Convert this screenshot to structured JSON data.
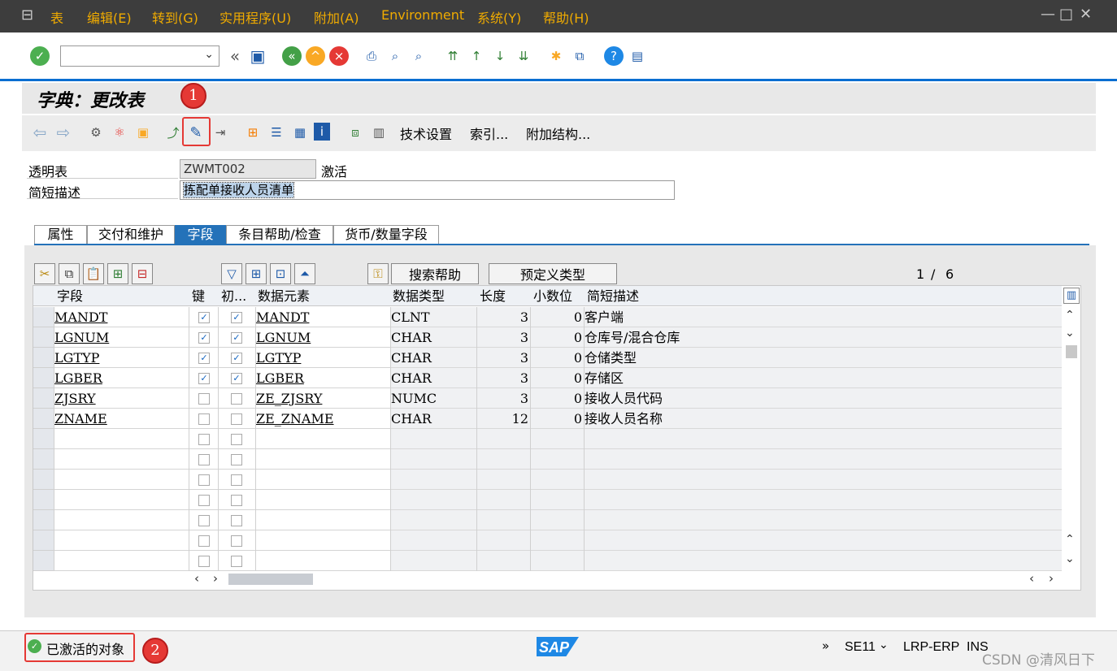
{
  "menu": {
    "items": [
      "表",
      "编辑(E)",
      "转到(G)",
      "实用程序(U)",
      "附加(A)",
      "Environment",
      "系统(Y)",
      "帮助(H)"
    ]
  },
  "window_controls": [
    "—",
    "□",
    "✕"
  ],
  "title": "字典：更改表",
  "app_toolbar": {
    "tech_settings": "技术设置",
    "index": "索引...",
    "append_structure": "附加结构..."
  },
  "form": {
    "table_label": "透明表",
    "table_name": "ZWMT002",
    "status": "激活",
    "desc_label": "简短描述",
    "desc_value": "拣配单接收人员清单"
  },
  "tabs": [
    "属性",
    "交付和维护",
    "字段",
    "条目帮助/检查",
    "货币/数量字段"
  ],
  "active_tab": "字段",
  "grid_toolbar": {
    "search_help": "搜索帮助",
    "predefined_type": "预定义类型",
    "page_current": "1",
    "page_sep": "/",
    "page_total": "6"
  },
  "columns": [
    "字段",
    "键",
    "初...",
    "数据元素",
    "数据类型",
    "长度",
    "小数位",
    "简短描述"
  ],
  "rows": [
    {
      "field": "MANDT",
      "key": true,
      "init": true,
      "element": "MANDT",
      "type": "CLNT",
      "length": "3",
      "decimals": "0",
      "desc": "客户端"
    },
    {
      "field": "LGNUM",
      "key": true,
      "init": true,
      "element": "LGNUM",
      "type": "CHAR",
      "length": "3",
      "decimals": "0",
      "desc": "仓库号/混合仓库"
    },
    {
      "field": "LGTYP",
      "key": true,
      "init": true,
      "element": "LGTYP",
      "type": "CHAR",
      "length": "3",
      "decimals": "0",
      "desc": "仓储类型"
    },
    {
      "field": "LGBER",
      "key": true,
      "init": true,
      "element": "LGBER",
      "type": "CHAR",
      "length": "3",
      "decimals": "0",
      "desc": "存储区"
    },
    {
      "field": "ZJSRY",
      "key": false,
      "init": false,
      "element": "ZE_ZJSRY",
      "type": "NUMC",
      "length": "3",
      "decimals": "0",
      "desc": "接收人员代码"
    },
    {
      "field": "ZNAME",
      "key": false,
      "init": false,
      "element": "ZE_ZNAME",
      "type": "CHAR",
      "length": "12",
      "decimals": "0",
      "desc": "接收人员名称"
    }
  ],
  "empty_rows": 7,
  "status_bar": {
    "message": "已激活的对象",
    "tcode": "SE11",
    "system": "LRP-ERP",
    "mode": "INS",
    "more": "»",
    "watermark": "CSDN @清风日下"
  },
  "annotations": {
    "marker1": "1",
    "marker2": "2"
  },
  "colors": {
    "menubar": "#3d3d3d",
    "menu_text": "#f0ab00",
    "accent": "#2472b9",
    "annotation": "#e53935"
  }
}
